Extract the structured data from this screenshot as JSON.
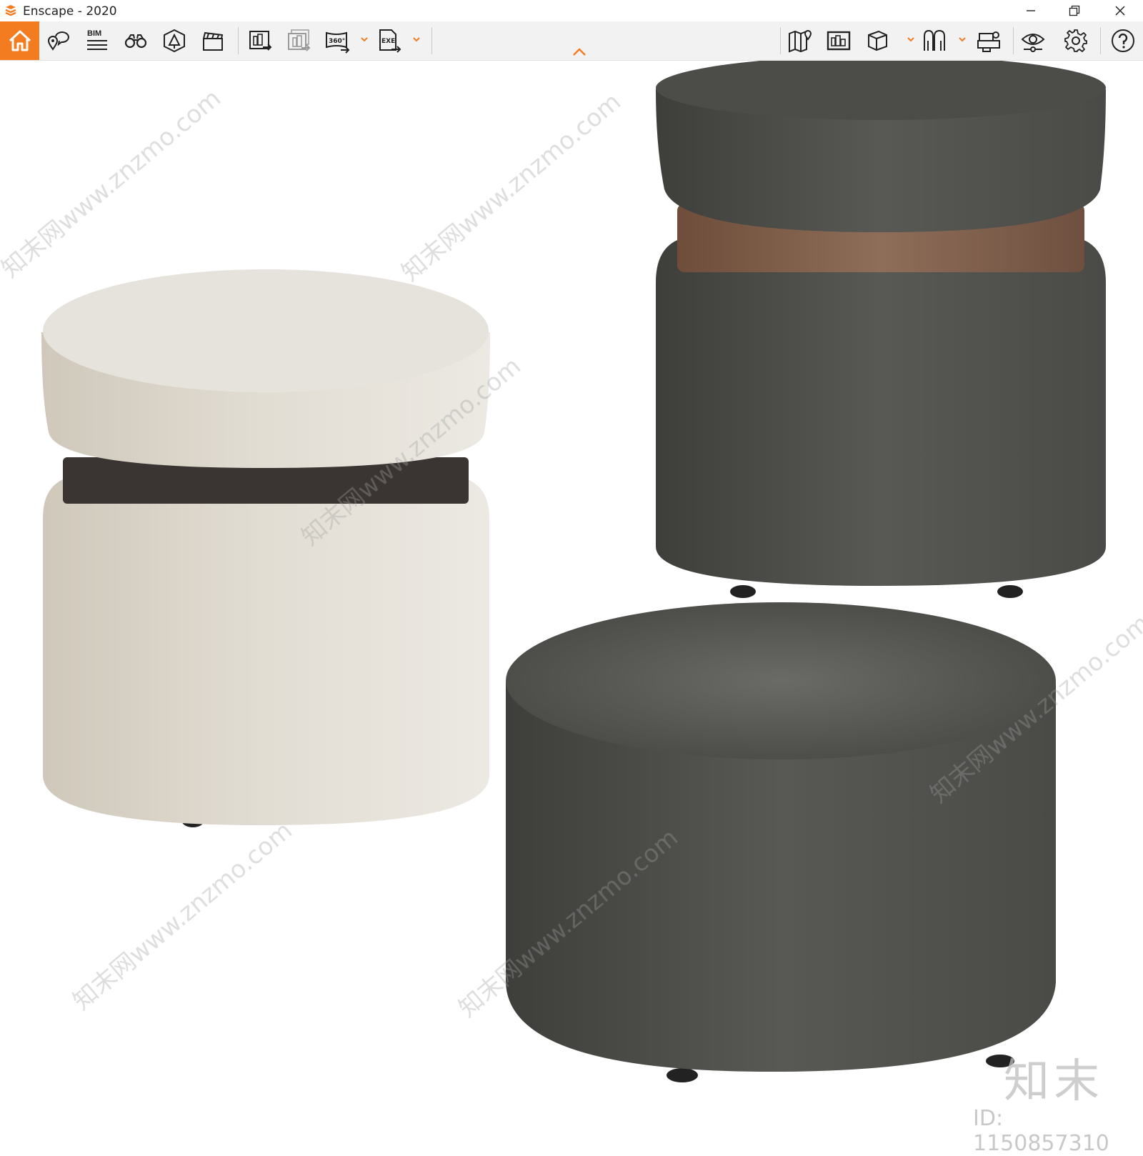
{
  "window": {
    "title": "Enscape - 2020",
    "accent_color": "#f47c20",
    "controls": [
      "minimize-icon",
      "restore-icon",
      "close-icon"
    ]
  },
  "toolbar": {
    "left_items": [
      "home-icon",
      "views-icon",
      "bim-icon",
      "binoculars-icon",
      "asset-library-icon",
      "video-editor-icon",
      "screenshot-icon",
      "batch-render-icon",
      "panorama-360-icon",
      "export-exe-icon"
    ],
    "bim_label": "BIM",
    "panorama_label": "360°",
    "exe_label": "EXE",
    "right_items": [
      "map-icon",
      "gallery-icon",
      "cube-icon",
      "vr-headset-icon",
      "collaboration-icon",
      "eye-visual-settings-icon",
      "gear-icon",
      "help-icon"
    ]
  },
  "viewport": {
    "objects": [
      {
        "name": "beige-ottoman",
        "fabric_color": "#d8d2c6",
        "band_color": "#3a3532"
      },
      {
        "name": "dark-ottoman-with-wood-band",
        "fabric_color": "#4a4a47",
        "band_color": "#7a5a45"
      },
      {
        "name": "dark-round-pouf",
        "fabric_color": "#4c4c49"
      }
    ],
    "watermark_text": "知末网www.znzmo.com",
    "logo_text": "知末",
    "id_text": "ID: 1150857310"
  }
}
